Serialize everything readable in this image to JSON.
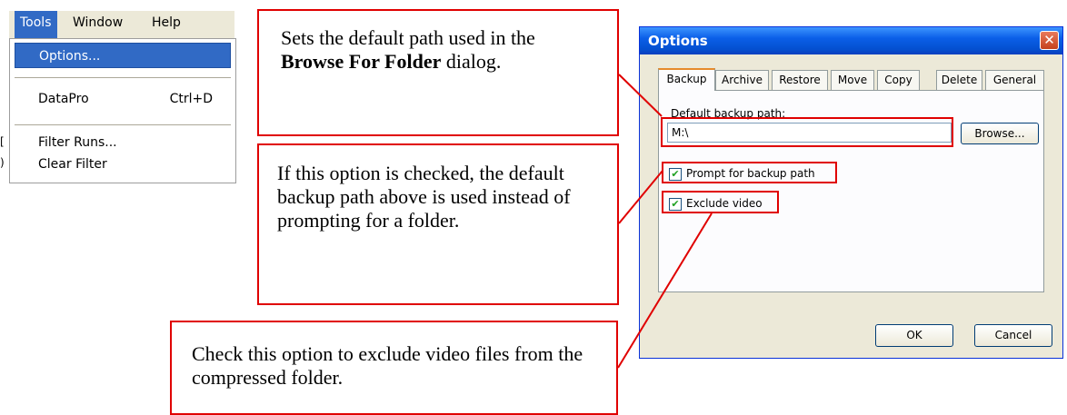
{
  "menu": {
    "bar": {
      "tools": "Tools",
      "window": "Window",
      "help": "Help"
    },
    "items": [
      {
        "label": "Options..."
      },
      {
        "label": "DataPro",
        "shortcut": "Ctrl+D"
      },
      {
        "label": "Filter Runs..."
      },
      {
        "label": "Clear Filter"
      }
    ],
    "left_edge": [
      "[",
      ")"
    ]
  },
  "callouts": {
    "c1": {
      "pre": "Sets the default path used in the ",
      "bold": "Browse For Folder",
      "post": " dialog."
    },
    "c2": {
      "text": "If this option is checked, the default backup path above is used instead of prompting for a folder."
    },
    "c3": {
      "text": "Check this option to exclude video files from the compressed folder."
    }
  },
  "dialog": {
    "title": "Options",
    "close_glyph": "✕",
    "tabs": [
      "Backup",
      "Archive",
      "Restore",
      "Move",
      "Copy",
      "Delete",
      "General"
    ],
    "default_path_label": "Default backup path:",
    "default_path_value": "M:\\",
    "browse_label": "Browse...",
    "prompt_label": "Prompt for backup path",
    "prompt_checked": true,
    "exclude_label": "Exclude video",
    "exclude_checked": true,
    "check_glyph": "✔",
    "ok_label": "OK",
    "cancel_label": "Cancel"
  },
  "colors": {
    "highlight": "#e00000",
    "menu_selected": "#316ac5",
    "titlebar": "#0450d0"
  }
}
